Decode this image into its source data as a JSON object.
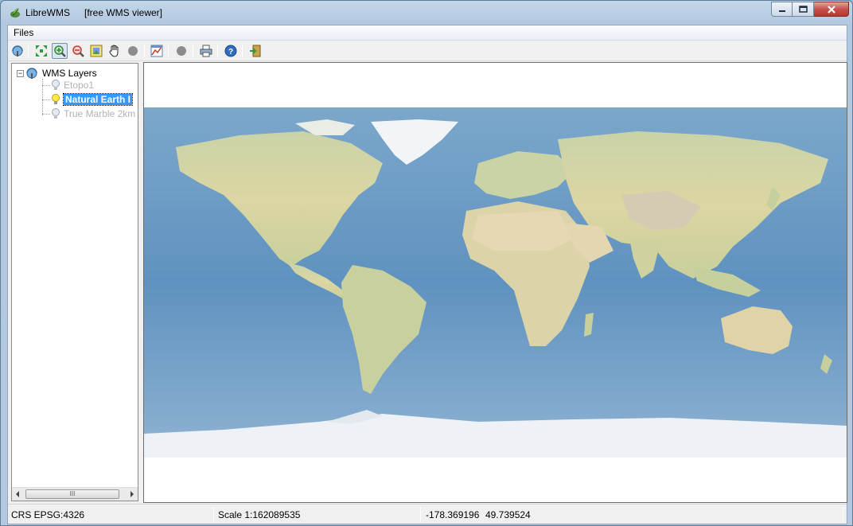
{
  "window": {
    "title": "LibreWMS",
    "subtitle": "[free WMS viewer]"
  },
  "menu": {
    "files_label": "Files"
  },
  "toolbar": {
    "icons": [
      "wms-connect-icon",
      "zoom-full-extent-icon",
      "zoom-in-icon",
      "zoom-out-icon",
      "zoom-layer-icon",
      "pan-hand-icon",
      "stop-icon",
      "identify-icon",
      "disabled-circle-icon",
      "print-icon",
      "help-icon",
      "exit-icon"
    ],
    "active": "zoom-in-icon"
  },
  "tree": {
    "root_label": "WMS Layers",
    "layers": [
      {
        "label": "Etopo1",
        "state": "off"
      },
      {
        "label": "Natural Earth I",
        "state": "selected"
      },
      {
        "label": "True Marble 2km",
        "state": "off"
      }
    ],
    "scroll_grip": "III"
  },
  "status": {
    "crs": "CRS EPSG:4326",
    "scale": "Scale 1:162089535",
    "lon": "-178.369196",
    "lat": "49.739524"
  },
  "colors": {
    "ocean": "#6e9cc4",
    "land": "#d9d6a2",
    "ice": "#eef2f6",
    "selection": "#3399ff"
  }
}
